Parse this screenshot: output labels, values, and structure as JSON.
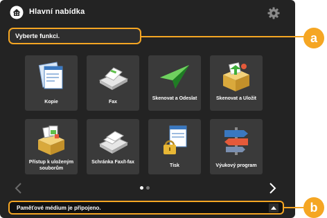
{
  "screen": {
    "title": "Hlavní nabídka",
    "prompt": "Vyberte funkci."
  },
  "tiles": [
    {
      "label": "Kopie",
      "icon": "copy-icon"
    },
    {
      "label": "Fax",
      "icon": "fax-icon"
    },
    {
      "label": "Skenovat a Odeslat",
      "icon": "scan-send-icon"
    },
    {
      "label": "Skenovat a Uložit",
      "icon": "scan-store-icon"
    },
    {
      "label": "Přístup k uloženým souborům",
      "icon": "stored-files-icon"
    },
    {
      "label": "Schránka Fax/I-fax",
      "icon": "fax-inbox-icon"
    },
    {
      "label": "Tisk",
      "icon": "print-icon"
    },
    {
      "label": "Výukový program",
      "icon": "tutorial-icon"
    }
  ],
  "pagination": {
    "current_page": 1,
    "total_pages": 2
  },
  "status": {
    "message": "Paměťové médium je připojeno."
  },
  "callouts": [
    "a",
    "b"
  ],
  "colors": {
    "accent": "#f5a623",
    "panel": "#232323",
    "tile": "#3a3a3a"
  }
}
